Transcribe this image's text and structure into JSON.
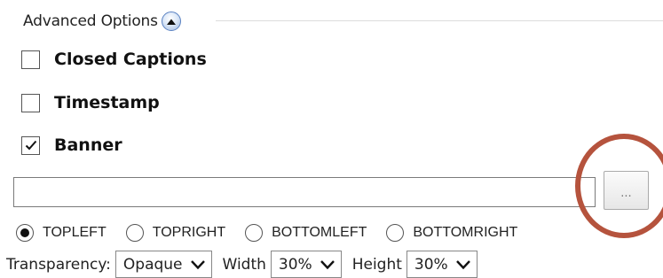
{
  "advanced_options": {
    "title": "Advanced Options",
    "collapse_icon": "chevron-up-icon"
  },
  "checkboxes": [
    {
      "label": "Closed Captions",
      "checked": false
    },
    {
      "label": "Timestamp",
      "checked": false
    },
    {
      "label": "Banner",
      "checked": true
    }
  ],
  "banner": {
    "path_value": "",
    "browse_label": "..."
  },
  "position": {
    "options": [
      "TOPLEFT",
      "TOPRIGHT",
      "BOTTOMLEFT",
      "BOTTOMRIGHT"
    ],
    "selected": "TOPLEFT"
  },
  "settings": {
    "transparency_label": "Transparency:",
    "transparency_value": "Opaque",
    "width_label": "Width",
    "width_value": "30%",
    "height_label": "Height",
    "height_value": "30%"
  },
  "colors": {
    "highlight_ring": "#b5533d",
    "collapse_button": "#5b82c2"
  }
}
